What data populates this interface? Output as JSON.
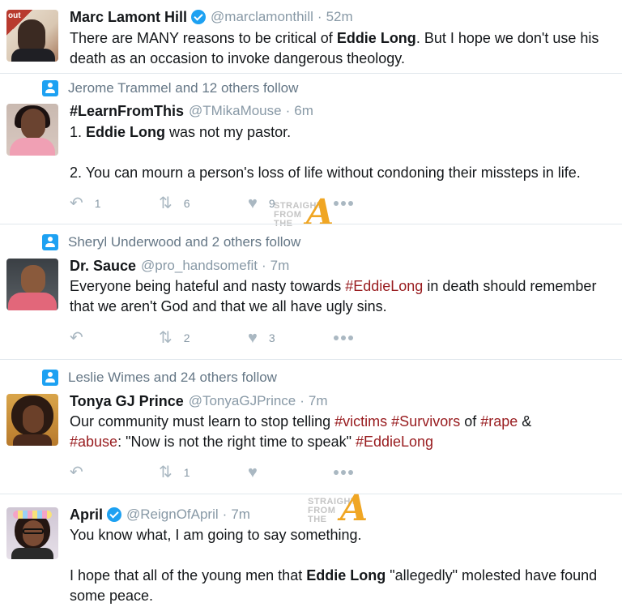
{
  "tweets": [
    {
      "context": "",
      "name": "Marc Lamont Hill",
      "verified": true,
      "handle": "@marclamonthill",
      "time": "52m",
      "avatar_tag": "out",
      "body": [
        {
          "t": "There are MANY reasons to be critical of "
        },
        {
          "t": "Eddie Long",
          "b": true
        },
        {
          "t": ". But I hope we don't use his death as an occasion to invoke dangerous theology."
        }
      ],
      "actions": null
    },
    {
      "context": "Jerome Trammel and 12 others follow",
      "name": "#LearnFromThis",
      "verified": false,
      "handle": "@TMikaMouse",
      "time": "6m",
      "body": [
        {
          "t": "1. "
        },
        {
          "t": "Eddie Long",
          "b": true
        },
        {
          "t": " was not my pastor."
        },
        {
          "br": 2
        },
        {
          "t": "2. You can mourn a person's loss of life without condoning their missteps in life."
        }
      ],
      "actions": {
        "replies": "1",
        "retweets": "6",
        "likes": "9"
      }
    },
    {
      "context": "Sheryl Underwood and 2 others follow",
      "name": "Dr. Sauce",
      "verified": false,
      "handle": "@pro_handsomefit",
      "time": "7m",
      "body": [
        {
          "t": "Everyone being hateful and nasty towards "
        },
        {
          "t": "#EddieLong",
          "h": true
        },
        {
          "t": " in death should remember that we aren't God and that we all have ugly sins."
        }
      ],
      "actions": {
        "replies": "",
        "retweets": "2",
        "likes": "3"
      }
    },
    {
      "context": "Leslie Wimes and 24 others follow",
      "name": "Tonya GJ Prince",
      "verified": false,
      "handle": "@TonyaGJPrince",
      "time": "7m",
      "body": [
        {
          "t": "Our community must learn to stop telling "
        },
        {
          "t": "#victims",
          "h": true
        },
        {
          "t": " "
        },
        {
          "t": "#Survivors",
          "h": true
        },
        {
          "t": " of "
        },
        {
          "t": "#rape",
          "h": true
        },
        {
          "t": " & "
        },
        {
          "br": 1
        },
        {
          "t": "#abuse",
          "h": true
        },
        {
          "t": ": \"Now is not the right time to speak\" "
        },
        {
          "t": "#EddieLong",
          "h": true
        }
      ],
      "actions": {
        "replies": "",
        "retweets": "1",
        "likes": ""
      }
    },
    {
      "context": "",
      "name": "April",
      "verified": true,
      "handle": "@ReignOfApril",
      "time": "7m",
      "body": [
        {
          "t": "You know what, I am going to say something."
        },
        {
          "br": 2
        },
        {
          "t": "I hope that all of the young men that "
        },
        {
          "t": "Eddie Long",
          "b": true
        },
        {
          "t": " \"allegedly\" molested have found some peace."
        }
      ],
      "actions": null
    }
  ],
  "watermark": {
    "line1": "STRAIGHT",
    "line2": "FROM",
    "line3": "THE",
    "letter": "A"
  },
  "icons": {
    "reply": "reply-icon",
    "retweet": "retweet-icon",
    "like": "heart-icon",
    "more": "more-icon",
    "context": "person-icon",
    "verified": "verified-badge-icon"
  },
  "colors": {
    "hashtag": "#981b1e",
    "meta": "#8899a6",
    "verified": "#1da1f2",
    "separator": "#e1e8ed",
    "watermark_a": "#f0a623"
  }
}
